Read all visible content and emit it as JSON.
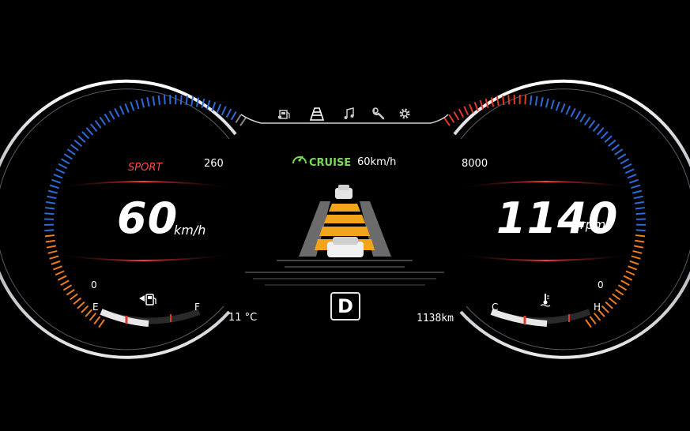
{
  "menu": {
    "icons": [
      {
        "name": "fuel-info-icon"
      },
      {
        "name": "driving-assist-icon"
      },
      {
        "name": "music-icon"
      },
      {
        "name": "wrench-icon"
      },
      {
        "name": "settings-gear-icon"
      }
    ],
    "active_index": 1
  },
  "speedometer": {
    "mode": "SPORT",
    "max_label": "260",
    "min_label": "0",
    "value": "60",
    "unit": "km/h",
    "fuel": {
      "empty_label": "E",
      "full_label": "F"
    }
  },
  "tachometer": {
    "max_label": "8000",
    "min_label": "0",
    "value": "1140",
    "unit": "rpm",
    "temp": {
      "cold_label": "C",
      "hot_label": "H"
    }
  },
  "cruise": {
    "label": "CRUISE",
    "set_speed": "60km/h"
  },
  "gear": "D",
  "outside_temp": "11 °C",
  "odometer": "1138km",
  "colors": {
    "accent_blue": "#2f6ad9",
    "accent_red": "#e23a2a",
    "accent_orange": "#f07a1c",
    "cruise_green": "#7ed957",
    "lane_yellow": "#f2a51a"
  }
}
